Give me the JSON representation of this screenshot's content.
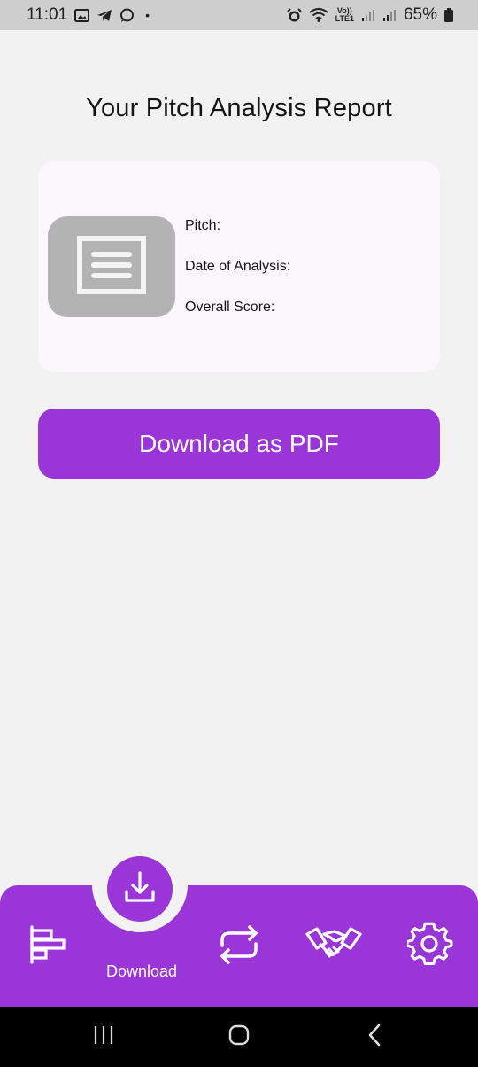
{
  "status_bar": {
    "time": "11:01",
    "dot": "•",
    "volte_top": "Vo))",
    "volte_bottom": "LTE1",
    "battery": "65%",
    "icons": [
      "gallery-icon",
      "telegram-icon",
      "whatsapp-icon",
      "alarm-icon",
      "wifi-icon",
      "signal-icon",
      "signal-icon",
      "battery-icon"
    ]
  },
  "page": {
    "title": "Your Pitch Analysis Report"
  },
  "report_card": {
    "thumbnail_icon": "document-icon",
    "fields": {
      "pitch_label": "Pitch:",
      "date_label": "Date of Analysis:",
      "score_label": "Overall Score:"
    }
  },
  "actions": {
    "download_pdf_label": "Download as PDF"
  },
  "bottom_nav": {
    "items": [
      {
        "icon": "bar-chart-icon"
      },
      {
        "icon": "download-icon",
        "label": "Download",
        "active": true
      },
      {
        "icon": "repeat-icon"
      },
      {
        "icon": "handshake-icon"
      },
      {
        "icon": "gear-icon"
      }
    ]
  },
  "system_nav": {
    "icons": [
      "recent-apps-icon",
      "home-icon",
      "back-icon"
    ]
  },
  "colors": {
    "accent": "#9a36d8",
    "background": "#f2f2f2",
    "card": "#fbf7fc",
    "thumbnail": "#b3b3b3",
    "status_bar": "#cfcfcf"
  }
}
